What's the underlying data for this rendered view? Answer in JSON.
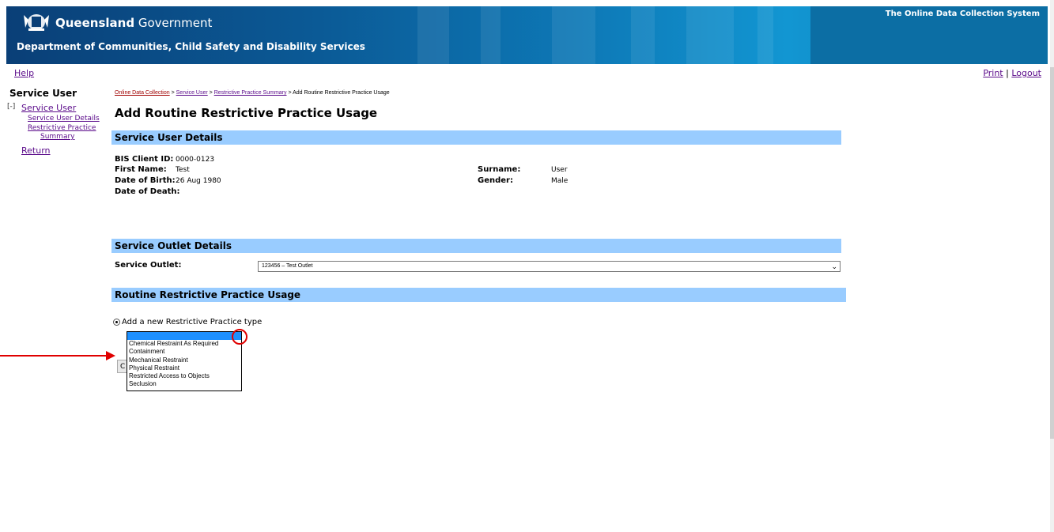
{
  "header": {
    "gov_name_bold": "Queensland",
    "gov_name_rest": " Government",
    "department": "Department of Communities, Child Safety and Disability Services",
    "system_name": "The Online Data Collection System"
  },
  "toplinks": {
    "help": "Help",
    "print": "Print",
    "separator": " | ",
    "logout": "Logout"
  },
  "nav": {
    "title": "Service User",
    "toggle": "[-]",
    "service_user": "Service User",
    "items": [
      {
        "label": "Service User Details"
      },
      {
        "label": "Restrictive Practice"
      },
      {
        "label": "Summary"
      }
    ],
    "return": "Return"
  },
  "breadcrumb": {
    "items": [
      "Online Data Collection",
      "Service User",
      "Restrictive Practice Summary"
    ],
    "separator": " > ",
    "current": "Add Routine Restrictive Practice Usage"
  },
  "page_title": "Add Routine Restrictive Practice Usage",
  "service_user_details": {
    "heading": "Service User Details",
    "bis_label": "BIS Client ID:",
    "bis_value": "0000-0123",
    "first_name_label": "First Name:",
    "first_name_value": "Test",
    "dob_label": "Date of Birth:",
    "dob_value": "26 Aug 1980",
    "dod_label": "Date of Death:",
    "surname_label": "Surname:",
    "surname_value": "User",
    "gender_label": "Gender:",
    "gender_value": "Male"
  },
  "service_outlet": {
    "heading": "Service Outlet Details",
    "label": "Service Outlet:",
    "selected": "123456 – Test Outlet"
  },
  "usage": {
    "heading": "Routine Restrictive Practice Usage",
    "radio_label": "Add a new Restrictive Practice type",
    "options": [
      "",
      "Chemical Restraint As Required",
      "Containment",
      "Mechanical Restraint",
      "Physical Restraint",
      "Restricted Access to Objects",
      "Seclusion"
    ],
    "partial_button": "C"
  },
  "colors": {
    "section_bar": "#99ccff",
    "link": "#5a0a8a",
    "annotation": "#e00000",
    "dropdown_highlight": "#1e90ff"
  }
}
